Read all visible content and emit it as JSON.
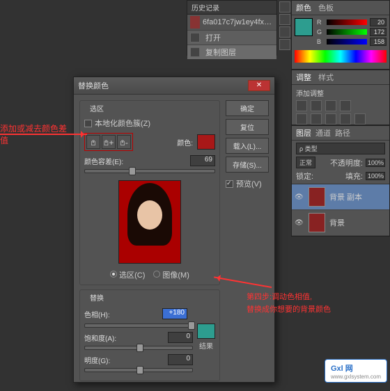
{
  "history": {
    "title": "历史记录",
    "doc": "6fa017c7jw1ey4fx6ps4c...",
    "items": [
      "打开",
      "复制图层"
    ]
  },
  "color": {
    "tab1": "颜色",
    "tab2": "色板",
    "r": {
      "label": "R",
      "val": "20"
    },
    "g": {
      "label": "G",
      "val": "172"
    },
    "b": {
      "label": "B",
      "val": "158"
    }
  },
  "adjust": {
    "tab1": "调整",
    "tab2": "样式",
    "add": "添加调整"
  },
  "layers": {
    "tabs": [
      "图层",
      "通道",
      "路径"
    ],
    "kind": "ρ 类型",
    "mode": "正常",
    "opacity_label": "不透明度:",
    "opacity": "100%",
    "lock": "锁定:",
    "fill_label": "填充:",
    "fill": "100%",
    "l1": "背景 副本",
    "l2": "背景"
  },
  "dialog": {
    "title": "替换颜色",
    "btn_ok": "确定",
    "btn_cancel": "复位",
    "btn_load": "载入(L)...",
    "btn_save": "存储(S)...",
    "preview_chk": "预览(V)",
    "sec_select": "选区",
    "chk_local": "本地化颜色簇(Z)",
    "color_label": "颜色:",
    "fuzz_label": "颜色容差(E):",
    "fuzz_val": "69",
    "radio_sel": "选区(C)",
    "radio_img": "图像(M)",
    "sec_replace": "替换",
    "hue_label": "色相(H):",
    "hue_val": "+180",
    "sat_label": "饱和度(A):",
    "sat_val": "0",
    "lig_label": "明度(G):",
    "lig_val": "0",
    "result": "结果",
    "src_color": "#a81818",
    "res_color": "#2d9d8f"
  },
  "anno1": "添加或减去颜色差值",
  "anno2a": "第四步:调动色相值,",
  "anno2b": "替换成你想要的背景颜色",
  "gxl": {
    "name": "Gxl 网",
    "url": "www.gxlsystem.com"
  }
}
